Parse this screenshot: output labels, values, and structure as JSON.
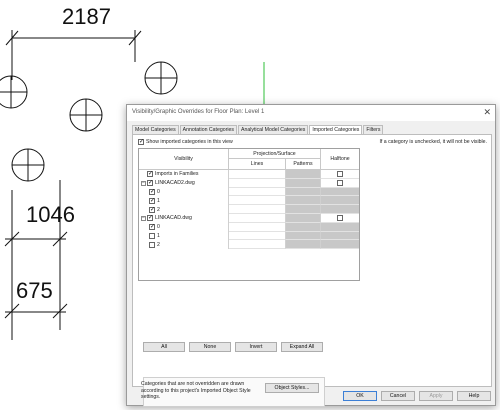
{
  "drawing": {
    "dimensions": [
      "2187",
      "1046",
      "675"
    ]
  },
  "dialog": {
    "title": "Visibility/Graphic Overrides for Floor Plan: Level 1",
    "close_glyph": "✕",
    "tabs": [
      {
        "label": "Model Categories",
        "active": false
      },
      {
        "label": "Annotation Categories",
        "active": false
      },
      {
        "label": "Analytical Model Categories",
        "active": false
      },
      {
        "label": "Imported Categories",
        "active": true
      },
      {
        "label": "Filters",
        "active": false
      }
    ],
    "show_imported_label": "Show imported categories in this view",
    "show_imported_checked": true,
    "hint": "If a category is unchecked, it will not be visible.",
    "table": {
      "headers": {
        "visibility": "Visibility",
        "projection_surface": "Projection/Surface",
        "lines": "Lines",
        "patterns": "Patterns",
        "halftone": "Halftone"
      },
      "rows": [
        {
          "label": "Imports in Families",
          "level": 0,
          "expander": "",
          "checked": true,
          "halftone": "box"
        },
        {
          "label": "LINKACAD2.dwg",
          "level": 0,
          "expander": "−",
          "checked": true,
          "halftone": "box"
        },
        {
          "label": "0",
          "level": 1,
          "expander": "",
          "checked": true,
          "halftone": "shade"
        },
        {
          "label": "1",
          "level": 1,
          "expander": "",
          "checked": true,
          "halftone": "shade"
        },
        {
          "label": "2",
          "level": 1,
          "expander": "",
          "checked": true,
          "halftone": "shade"
        },
        {
          "label": "LINKACAD.dwg",
          "level": 0,
          "expander": "−",
          "checked": true,
          "halftone": "box"
        },
        {
          "label": "0",
          "level": 1,
          "expander": "",
          "checked": true,
          "halftone": "shade"
        },
        {
          "label": "1",
          "level": 1,
          "expander": "",
          "checked": false,
          "halftone": "shade"
        },
        {
          "label": "2",
          "level": 1,
          "expander": "",
          "checked": false,
          "halftone": "shade"
        }
      ]
    },
    "buttons": {
      "all": "All",
      "none": "None",
      "invert": "Invert",
      "expand_all": "Expand All",
      "object_styles": "Object Styles...",
      "ok": "OK",
      "cancel": "Cancel",
      "apply": "Apply",
      "help": "Help"
    },
    "info_text": "Categories that are not overridden are drawn according to this project's Imported Object Style settings."
  }
}
